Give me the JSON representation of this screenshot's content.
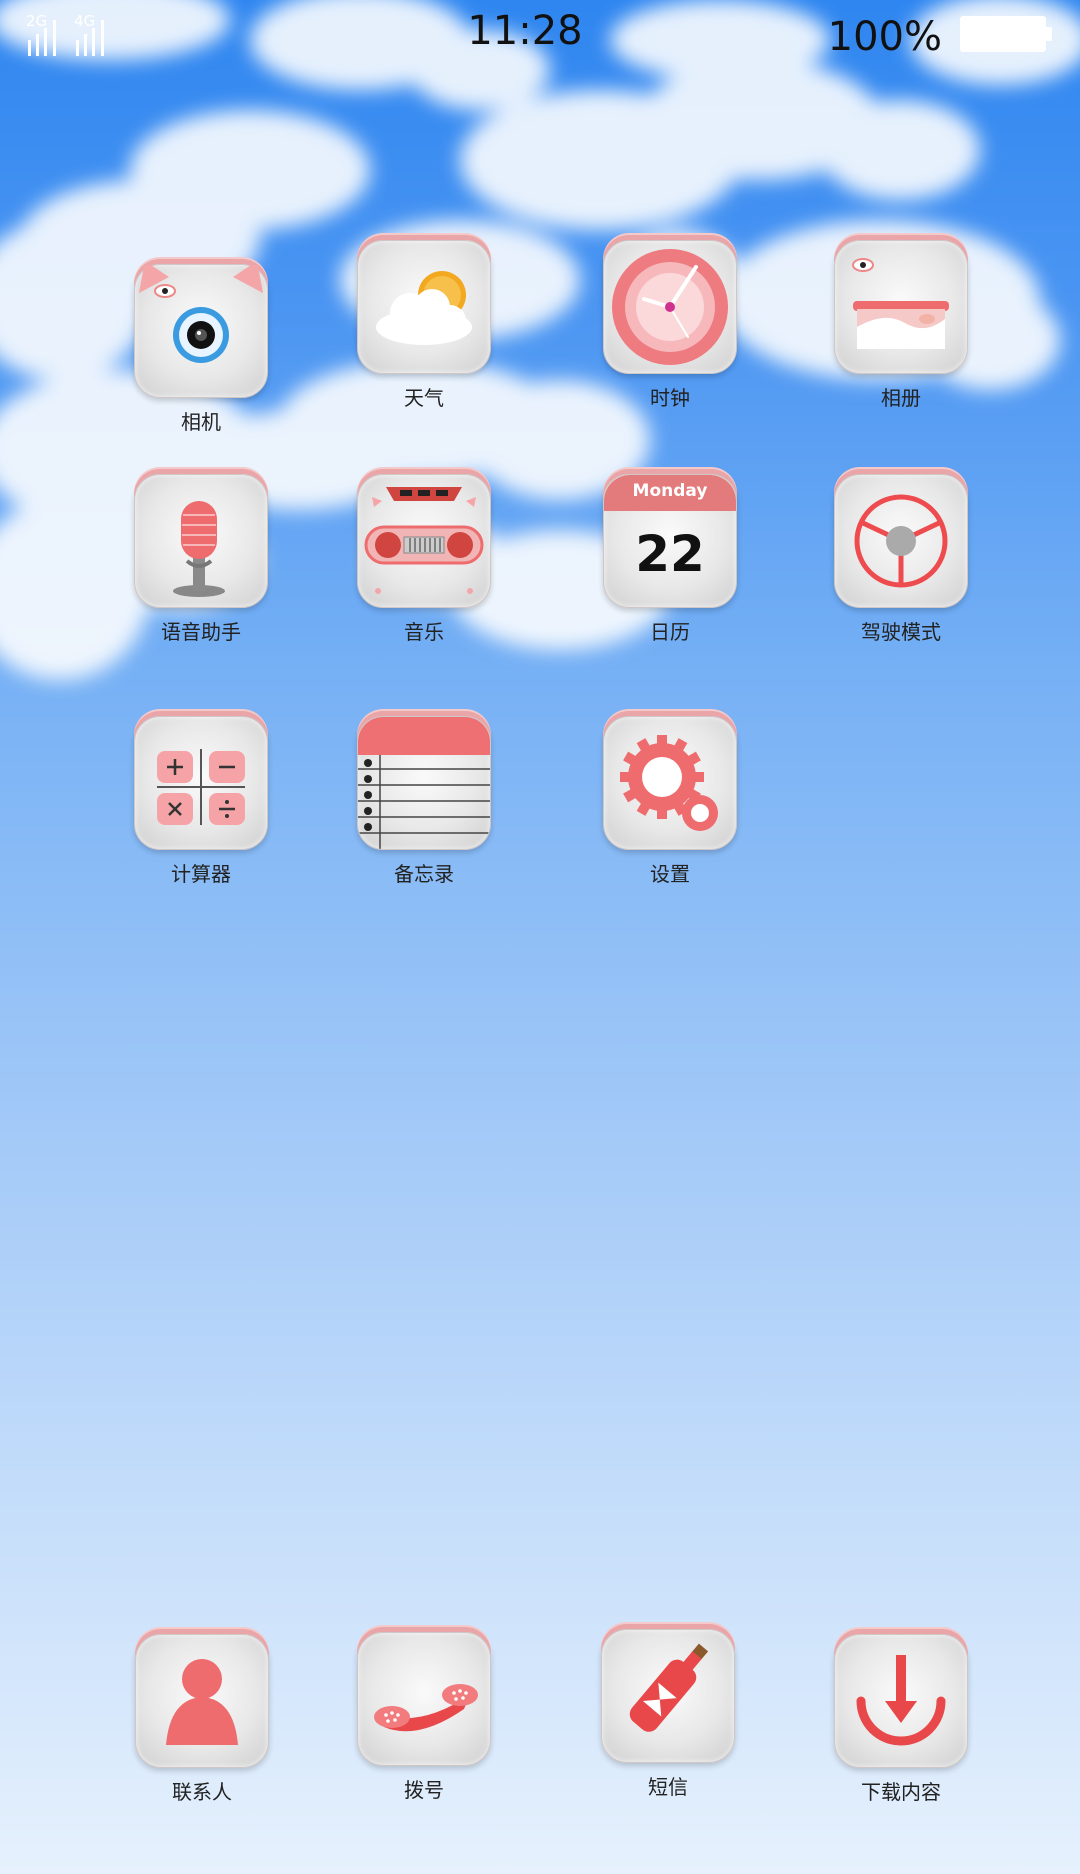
{
  "status_bar": {
    "signal_1_label": "2G",
    "signal_2_label": "4G",
    "time": "11:28",
    "battery_text": "100%",
    "battery_level": 1.0
  },
  "apps": {
    "camera": "相机",
    "weather": "天气",
    "clock": "时钟",
    "album": "相册",
    "voice_assistant": "语音助手",
    "music": "音乐",
    "calendar": "日历",
    "calendar_day": "Monday",
    "calendar_date": "22",
    "driving_mode": "驾驶模式",
    "calculator": "计算器",
    "notes": "备忘录",
    "settings": "设置"
  },
  "dock": {
    "contacts": "联系人",
    "dialer": "拨号",
    "messages": "短信",
    "downloads": "下载内容"
  },
  "colors": {
    "accent": "#ee6b6e",
    "sky_top": "#2f86f0",
    "sky_bottom": "#e6f1fd"
  }
}
